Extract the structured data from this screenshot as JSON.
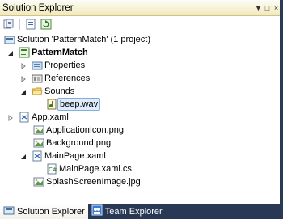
{
  "window": {
    "title": "Solution Explorer",
    "controls": [
      "▼",
      "□",
      "×"
    ]
  },
  "toolbar": {
    "buttons": [
      "show-all-files-icon",
      "properties-icon",
      "refresh-icon"
    ]
  },
  "tree": [
    {
      "label": "Solution 'PatternMatch' (1 project)",
      "icon": "solution-icon",
      "expander": "expanded"
    },
    {
      "label": "PatternMatch",
      "icon": "project-icon",
      "expander": "expanded",
      "bold": true
    },
    {
      "label": "Properties",
      "icon": "properties-folder-icon",
      "expander": "collapsed"
    },
    {
      "label": "References",
      "icon": "references-icon",
      "expander": "collapsed"
    },
    {
      "label": "Sounds",
      "icon": "folder-icon",
      "expander": "expanded"
    },
    {
      "label": "beep.wav",
      "icon": "audio-file-icon",
      "expander": "none",
      "selected": true
    },
    {
      "label": "App.xaml",
      "icon": "xaml-file-icon",
      "expander": "collapsed"
    },
    {
      "label": "ApplicationIcon.png",
      "icon": "image-file-icon",
      "expander": "none"
    },
    {
      "label": "Background.png",
      "icon": "image-file-icon",
      "expander": "none"
    },
    {
      "label": "MainPage.xaml",
      "icon": "xaml-file-icon",
      "expander": "expanded"
    },
    {
      "label": "MainPage.xaml.cs",
      "icon": "cs-file-icon",
      "expander": "none"
    },
    {
      "label": "SplashScreenImage.jpg",
      "icon": "image-file-icon",
      "expander": "none"
    }
  ],
  "tabs": [
    {
      "label": "Solution Explorer",
      "icon": "solution-explorer-icon",
      "active": true
    },
    {
      "label": "Team Explorer",
      "icon": "team-explorer-icon",
      "active": false
    }
  ],
  "colors": {
    "frame": "#293955",
    "title_bg": "#f1e9b9",
    "selection_bg": "#dfecfb",
    "selection_border": "#84acdd"
  }
}
